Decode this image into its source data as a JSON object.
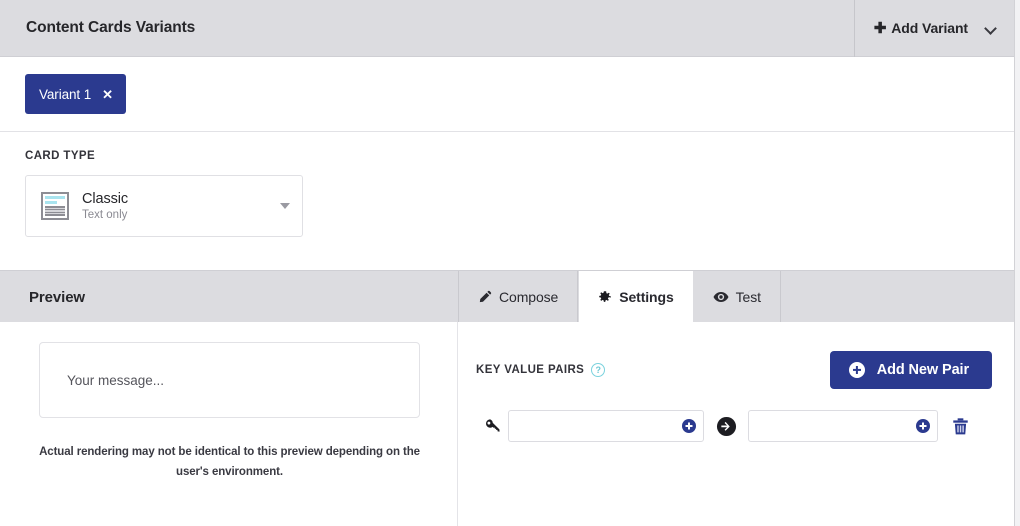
{
  "header": {
    "title": "Content Cards Variants",
    "add_variant_label": "Add Variant",
    "plus_glyph": "✚",
    "dropdown_icon": "chevron-down-icon"
  },
  "variants": {
    "items": [
      {
        "label": "Variant 1",
        "close_glyph": "✕",
        "active": true
      }
    ]
  },
  "card_type": {
    "section_label": "CARD TYPE",
    "selected": {
      "name": "Classic",
      "subtitle": "Text only"
    },
    "dropdown_icon": "caret-down-icon"
  },
  "preview_bar": {
    "label": "Preview",
    "tabs": [
      {
        "label": "Compose",
        "icon": "pencil-icon",
        "active": false
      },
      {
        "label": "Settings",
        "icon": "gear-icon",
        "active": true
      },
      {
        "label": "Test",
        "icon": "eye-icon",
        "active": false
      }
    ]
  },
  "preview_pane": {
    "message_placeholder": "Your message...",
    "disclaimer": "Actual rendering may not be identical to this preview depending on the user's environment."
  },
  "settings_pane": {
    "kvp_title": "KEY VALUE PAIRS",
    "help_glyph": "?",
    "add_new_pair_label": "Add New Pair",
    "rows": [
      {
        "key_icon": "key-icon",
        "key_value": "",
        "key_placeholder": "",
        "separator_icon": "arrow-right-circle-icon",
        "value_value": "",
        "value_placeholder": "",
        "delete_icon": "trash-icon"
      }
    ]
  },
  "colors": {
    "brand_navy": "#2b3a8f",
    "header_gray": "#dcdce0",
    "help_teal": "#6ec8d5"
  }
}
